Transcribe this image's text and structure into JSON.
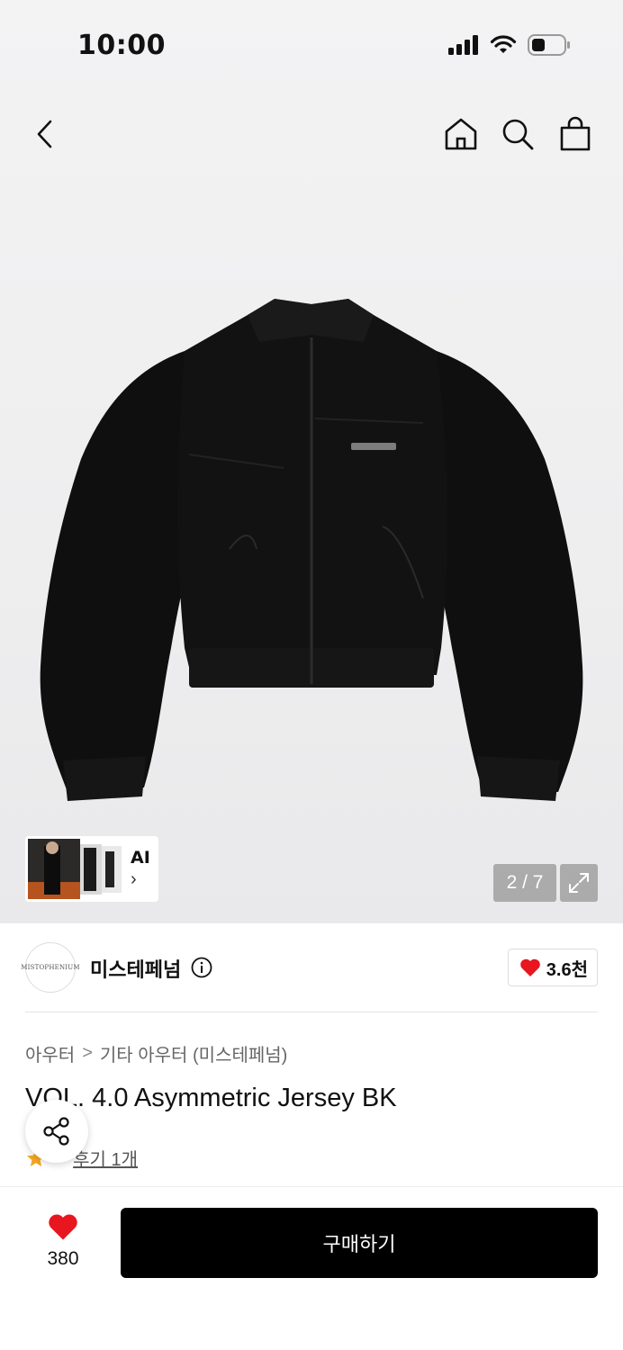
{
  "status_bar": {
    "time": "10:00"
  },
  "nav": {
    "back": "back-arrow-icon",
    "home": "home-icon",
    "search": "search-icon",
    "cart": "shopping-bag-icon"
  },
  "gallery": {
    "ai_label": "AI",
    "page_counter": "2 / 7"
  },
  "brand": {
    "logo_text": "MISTOPHENIUM",
    "name": "미스테페넘",
    "like_count": "3.6천"
  },
  "breadcrumb": {
    "category": "아우터",
    "separator": ">",
    "subcategory": "기타 아우터 (미스테페넘)"
  },
  "product": {
    "title": "VOL. 4.0 Asymmetric Jersey BK",
    "rating": "5",
    "review_link": "후기 1개"
  },
  "bottom": {
    "wish_count": "380",
    "buy_label": "구매하기"
  },
  "colors": {
    "heart": "#e8161f",
    "star": "#f5a623",
    "buy_bg": "#000000"
  }
}
